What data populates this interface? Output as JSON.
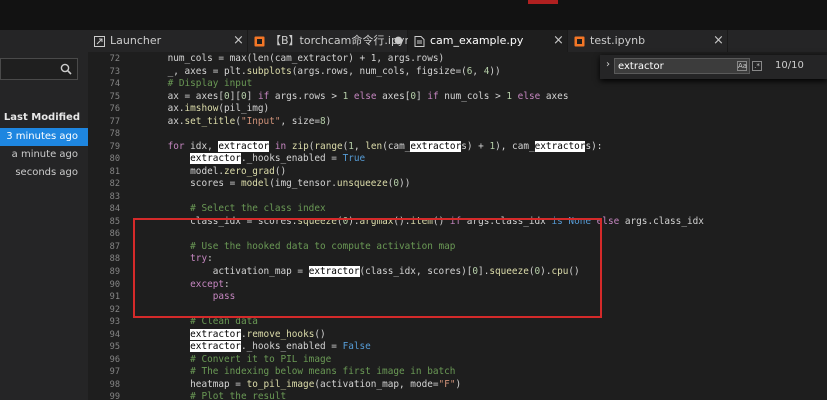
{
  "sidebar": {
    "search_value": "",
    "column_header": "Last Modified",
    "rows": [
      {
        "text": "3 minutes ago",
        "selected": true
      },
      {
        "text": "a minute ago",
        "selected": false
      },
      {
        "text": "seconds ago",
        "selected": false
      }
    ]
  },
  "tabs": [
    {
      "label": "Launcher",
      "icon": "launcher-icon",
      "close": "×",
      "active": false
    },
    {
      "label": "【B】torchcam命令行.ipynb",
      "icon": "notebook-icon",
      "close": "●",
      "active": false
    },
    {
      "label": "cam_example.py",
      "icon": "python-file-icon",
      "close": "×",
      "active": true
    },
    {
      "label": "test.ipynb",
      "icon": "notebook-icon",
      "close": "×",
      "active": false
    }
  ],
  "find": {
    "value": "extractor",
    "toggle_case": "Aa",
    "toggle_regex": ".*",
    "count": "10/10",
    "colors": {
      "highlight": "#ffffff",
      "box": "#d52a2a",
      "accent": "#1e86e0"
    }
  },
  "editor": {
    "lines": [
      {
        "n": "72",
        "tokens": [
          {
            "t": "    num_cols = max(len(cam_extractor) + 1, args.rows)",
            "c": "op"
          }
        ]
      },
      {
        "n": "73",
        "tokens": [
          {
            "t": "    _, axes = plt.",
            "c": "op"
          },
          {
            "t": "subplots",
            "c": "fn"
          },
          {
            "t": "(args.rows, num_cols, figsize=(",
            "c": "op"
          },
          {
            "t": "6",
            "c": "nm"
          },
          {
            "t": ", ",
            "c": "op"
          },
          {
            "t": "4",
            "c": "nm"
          },
          {
            "t": "))",
            "c": "op"
          }
        ]
      },
      {
        "n": "74",
        "tokens": [
          {
            "t": "    # Display input",
            "c": "cm"
          }
        ]
      },
      {
        "n": "75",
        "tokens": [
          {
            "t": "    ax = axes[",
            "c": "op"
          },
          {
            "t": "0",
            "c": "nm"
          },
          {
            "t": "][",
            "c": "op"
          },
          {
            "t": "0",
            "c": "nm"
          },
          {
            "t": "] ",
            "c": "op"
          },
          {
            "t": "if",
            "c": "kw"
          },
          {
            "t": " args.rows > ",
            "c": "op"
          },
          {
            "t": "1",
            "c": "nm"
          },
          {
            "t": " ",
            "c": "op"
          },
          {
            "t": "else",
            "c": "kw"
          },
          {
            "t": " axes[",
            "c": "op"
          },
          {
            "t": "0",
            "c": "nm"
          },
          {
            "t": "] ",
            "c": "op"
          },
          {
            "t": "if",
            "c": "kw"
          },
          {
            "t": " num_cols > ",
            "c": "op"
          },
          {
            "t": "1",
            "c": "nm"
          },
          {
            "t": " ",
            "c": "op"
          },
          {
            "t": "else",
            "c": "kw"
          },
          {
            "t": " axes",
            "c": "op"
          }
        ]
      },
      {
        "n": "76",
        "tokens": [
          {
            "t": "    ax.",
            "c": "op"
          },
          {
            "t": "imshow",
            "c": "fn"
          },
          {
            "t": "(pil_img)",
            "c": "op"
          }
        ]
      },
      {
        "n": "77",
        "tokens": [
          {
            "t": "    ax.",
            "c": "op"
          },
          {
            "t": "set_title",
            "c": "fn"
          },
          {
            "t": "(",
            "c": "op"
          },
          {
            "t": "\"Input\"",
            "c": "st"
          },
          {
            "t": ", size=",
            "c": "op"
          },
          {
            "t": "8",
            "c": "nm"
          },
          {
            "t": ")",
            "c": "op"
          }
        ]
      },
      {
        "n": "78",
        "tokens": [
          {
            "t": "",
            "c": "op"
          }
        ]
      },
      {
        "n": "79",
        "tokens": [
          {
            "t": "    ",
            "c": "op"
          },
          {
            "t": "for",
            "c": "kw"
          },
          {
            "t": " idx, ",
            "c": "op"
          },
          {
            "t": "extractor",
            "c": "hl"
          },
          {
            "t": " ",
            "c": "op"
          },
          {
            "t": "in",
            "c": "kw"
          },
          {
            "t": " ",
            "c": "op"
          },
          {
            "t": "zip",
            "c": "fn"
          },
          {
            "t": "(",
            "c": "op"
          },
          {
            "t": "range",
            "c": "fn"
          },
          {
            "t": "(",
            "c": "op"
          },
          {
            "t": "1",
            "c": "nm"
          },
          {
            "t": ", ",
            "c": "op"
          },
          {
            "t": "len",
            "c": "fn"
          },
          {
            "t": "(cam_",
            "c": "op"
          },
          {
            "t": "extractor",
            "c": "hl"
          },
          {
            "t": "s) + ",
            "c": "op"
          },
          {
            "t": "1",
            "c": "nm"
          },
          {
            "t": "), cam_",
            "c": "op"
          },
          {
            "t": "extractor",
            "c": "hl"
          },
          {
            "t": "s):",
            "c": "op"
          }
        ]
      },
      {
        "n": "80",
        "tokens": [
          {
            "t": "        ",
            "c": "op"
          },
          {
            "t": "extractor",
            "c": "hl"
          },
          {
            "t": "._hooks_enabled = ",
            "c": "op"
          },
          {
            "t": "True",
            "c": "kb"
          }
        ]
      },
      {
        "n": "81",
        "tokens": [
          {
            "t": "        model.",
            "c": "op"
          },
          {
            "t": "zero_grad",
            "c": "fn"
          },
          {
            "t": "()",
            "c": "op"
          }
        ]
      },
      {
        "n": "82",
        "tokens": [
          {
            "t": "        scores = ",
            "c": "op"
          },
          {
            "t": "model",
            "c": "fn"
          },
          {
            "t": "(img_tensor.",
            "c": "op"
          },
          {
            "t": "unsqueeze",
            "c": "fn"
          },
          {
            "t": "(",
            "c": "op"
          },
          {
            "t": "0",
            "c": "nm"
          },
          {
            "t": "))",
            "c": "op"
          }
        ]
      },
      {
        "n": "83",
        "tokens": [
          {
            "t": "",
            "c": "op"
          }
        ]
      },
      {
        "n": "84",
        "tokens": [
          {
            "t": "        # Select the class index",
            "c": "cm"
          }
        ]
      },
      {
        "n": "85",
        "tokens": [
          {
            "t": "        class_idx = scores.",
            "c": "op"
          },
          {
            "t": "squeeze",
            "c": "fn"
          },
          {
            "t": "(",
            "c": "op"
          },
          {
            "t": "0",
            "c": "nm"
          },
          {
            "t": ").",
            "c": "op"
          },
          {
            "t": "argmax",
            "c": "fn"
          },
          {
            "t": "().",
            "c": "op"
          },
          {
            "t": "item",
            "c": "fn"
          },
          {
            "t": "() ",
            "c": "op"
          },
          {
            "t": "if",
            "c": "kw"
          },
          {
            "t": " args.class_idx ",
            "c": "op"
          },
          {
            "t": "is",
            "c": "kb"
          },
          {
            "t": " ",
            "c": "op"
          },
          {
            "t": "None",
            "c": "kb"
          },
          {
            "t": " ",
            "c": "op"
          },
          {
            "t": "else",
            "c": "kw"
          },
          {
            "t": " args.class_idx",
            "c": "op"
          }
        ]
      },
      {
        "n": "86",
        "tokens": [
          {
            "t": "",
            "c": "op"
          }
        ]
      },
      {
        "n": "87",
        "tokens": [
          {
            "t": "        # Use the hooked data to compute activation map",
            "c": "cm"
          }
        ]
      },
      {
        "n": "88",
        "tokens": [
          {
            "t": "        ",
            "c": "op"
          },
          {
            "t": "try",
            "c": "kw"
          },
          {
            "t": ":",
            "c": "op"
          }
        ]
      },
      {
        "n": "89",
        "tokens": [
          {
            "t": "            activation_map = ",
            "c": "op"
          },
          {
            "t": "extractor",
            "c": "hl"
          },
          {
            "t": "(class_idx, scores)[",
            "c": "op"
          },
          {
            "t": "0",
            "c": "nm"
          },
          {
            "t": "].",
            "c": "op"
          },
          {
            "t": "squeeze",
            "c": "fn"
          },
          {
            "t": "(",
            "c": "op"
          },
          {
            "t": "0",
            "c": "nm"
          },
          {
            "t": ").",
            "c": "op"
          },
          {
            "t": "cpu",
            "c": "fn"
          },
          {
            "t": "()",
            "c": "op"
          }
        ]
      },
      {
        "n": "90",
        "tokens": [
          {
            "t": "        ",
            "c": "op"
          },
          {
            "t": "except",
            "c": "kw"
          },
          {
            "t": ":",
            "c": "op"
          }
        ]
      },
      {
        "n": "91",
        "tokens": [
          {
            "t": "            ",
            "c": "op"
          },
          {
            "t": "pass",
            "c": "kw"
          }
        ]
      },
      {
        "n": "92",
        "tokens": [
          {
            "t": "",
            "c": "op"
          }
        ]
      },
      {
        "n": "93",
        "tokens": [
          {
            "t": "        # Clean data",
            "c": "cm"
          }
        ]
      },
      {
        "n": "94",
        "tokens": [
          {
            "t": "        ",
            "c": "op"
          },
          {
            "t": "extractor",
            "c": "hl"
          },
          {
            "t": ".",
            "c": "op"
          },
          {
            "t": "remove_hooks",
            "c": "fn"
          },
          {
            "t": "()",
            "c": "op"
          }
        ]
      },
      {
        "n": "95",
        "tokens": [
          {
            "t": "        ",
            "c": "op"
          },
          {
            "t": "extractor",
            "c": "hl"
          },
          {
            "t": "._hooks_enabled = ",
            "c": "op"
          },
          {
            "t": "False",
            "c": "kb"
          }
        ]
      },
      {
        "n": "96",
        "tokens": [
          {
            "t": "        # Convert it to PIL image",
            "c": "cm"
          }
        ]
      },
      {
        "n": "97",
        "tokens": [
          {
            "t": "        # The indexing below means first image in batch",
            "c": "cm"
          }
        ]
      },
      {
        "n": "98",
        "tokens": [
          {
            "t": "        heatmap = ",
            "c": "op"
          },
          {
            "t": "to_pil_image",
            "c": "fn"
          },
          {
            "t": "(activation_map, mode=",
            "c": "op"
          },
          {
            "t": "\"F\"",
            "c": "st"
          },
          {
            "t": ")",
            "c": "op"
          }
        ]
      },
      {
        "n": "99",
        "tokens": [
          {
            "t": "        # Plot the result",
            "c": "cm"
          }
        ]
      }
    ]
  }
}
